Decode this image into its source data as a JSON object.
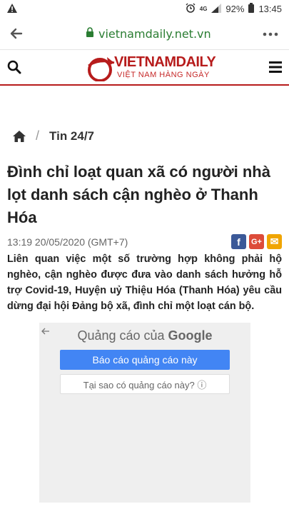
{
  "status_bar": {
    "network": "4G",
    "battery": "92%",
    "time": "13:45"
  },
  "browser": {
    "url": "vietnamdaily.net.vn"
  },
  "site": {
    "logo_title_red": "VIETNAM",
    "logo_title_dark": "DAILY",
    "logo_subtitle": "VIỆT NAM HÀNG NGÀY"
  },
  "breadcrumb": {
    "separator": "/",
    "category": "Tin 24/7"
  },
  "article": {
    "title": "Đình chỉ loạt quan xã có người nhà lọt danh sách cận nghèo ở Thanh Hóa",
    "datetime": "13:19 20/05/2020 (GMT+7)",
    "lead": "Liên quan việc một số trường hợp không phải hộ nghèo, cận nghèo được đưa vào danh sách hưởng hỗ trợ Covid-19, Huyện uỷ Thiệu Hóa (Thanh Hóa) yêu cầu dừng đại hội Đảng bộ xã, đình chỉ một loạt cán bộ.",
    "share": {
      "facebook": "f",
      "google_plus": "G+",
      "email": "✉"
    }
  },
  "ad": {
    "header_prefix": "Quảng cáo của",
    "header_brand": "Google",
    "report_button": "Báo cáo quảng cáo này",
    "why_button": "Tại sao có quảng cáo này? ⓘ"
  },
  "colors": {
    "brand_red": "#b71c1c",
    "url_green": "#2a7d32",
    "ad_blue": "#4285f4",
    "facebook": "#3b5998",
    "google_plus": "#dd4b39",
    "email": "#f0a500"
  }
}
